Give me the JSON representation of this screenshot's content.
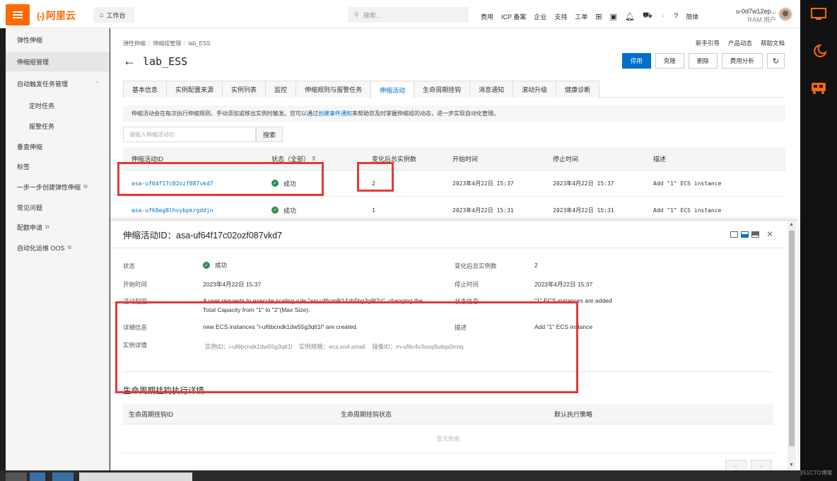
{
  "colors": {
    "brand": "#ff6a00",
    "primary": "#0070cc",
    "success": "#2e8b57",
    "highlight": "#e53935"
  },
  "topbar": {
    "logo": "阿里云",
    "logo_mark": "(-)",
    "workbench": "工作台",
    "search_placeholder": "搜索...",
    "nav": [
      "费用",
      "ICP 备案",
      "企业",
      "支持",
      "工单"
    ],
    "lang": "简体",
    "user_name": "u-0d7w12ep...",
    "user_role": "RAM 用户"
  },
  "sidebar": {
    "items": [
      {
        "label": "弹性伸缩"
      },
      {
        "label": "伸缩组管理"
      },
      {
        "label": "自动触发任务管理"
      },
      {
        "label": "定时任务"
      },
      {
        "label": "报警任务"
      },
      {
        "label": "垂直伸缩"
      },
      {
        "label": "标签"
      },
      {
        "label": "一步一步创建弹性伸缩"
      },
      {
        "label": "常见问题"
      },
      {
        "label": "配额申请"
      },
      {
        "label": "自动化运维 OOS"
      }
    ]
  },
  "breadcrumb": [
    "弹性伸缩",
    "伸缩组管理",
    "lab_ESS"
  ],
  "toplinks": [
    "新手引导",
    "产品动态",
    "帮助文档"
  ],
  "page_title": "lab_ESS",
  "actions": [
    "停用",
    "克隆",
    "删除",
    "费用分析"
  ],
  "tabs": [
    "基本信息",
    "实例配置来源",
    "实例列表",
    "监控",
    "伸缩规则与报警任务",
    "伸缩活动",
    "生命周期挂钩",
    "消息通知",
    "滚动升级",
    "健康诊断"
  ],
  "notice": {
    "before": "伸缩活动会在每次执行伸缩规则、手动添加或移出实例时触发。您可以通过",
    "link": "创建事件通知",
    "after": "来帮助您及时掌握伸缩组的动态，进一步实现自动化管理。"
  },
  "filter": {
    "placeholder": "请输入伸缩活动ID",
    "button": "搜索"
  },
  "table": {
    "headers": [
      "伸缩活动ID",
      "状态（全部）",
      "变化后总实例数",
      "开始时间",
      "停止时间",
      "描述"
    ],
    "rows": [
      {
        "id": "asa-uf64f17c02ozf087vkd7",
        "status": "成功",
        "count": "2",
        "start": "2023年4月22日 15:37",
        "stop": "2023年4月22日 15:37",
        "desc": "Add \"1\" ECS instance"
      },
      {
        "id": "asa-uf68eg8lhvybpkrgddjn",
        "status": "成功",
        "count": "1",
        "start": "2023年4月22日 15:31",
        "stop": "2023年4月22日 15:31",
        "desc": "Add \"1\" ECS instance"
      }
    ]
  },
  "drawer": {
    "title": "伸缩活动ID：asa-uf64f17c02ozf087vkd7",
    "labels": {
      "status": "状态",
      "start": "开始时间",
      "cause": "活动起因",
      "detail": "详细信息",
      "instance_detail": "实例详情",
      "count": "变化后总实例数",
      "stop": "停止时间",
      "status_info": "状态信息",
      "desc": "描述"
    },
    "values": {
      "status": "成功",
      "start": "2023年4月22日 15:37",
      "cause_line1": "A user requests to execute scaling rule \"asr-uf6cm9i14zb5bg3g9t7q\", changing the",
      "cause_line2": "Total Capacity from \"1\" to \"2\"(Max Size).",
      "detail": "new ECS instances \"i-uf6bcndk1dw55g3qtl1l\" are created.",
      "instance_detail": "实例ID：i-uf6bcndk1dw55g3qtl1l    实例规格：ecs.xn4.small    镜像ID：m-uf6c4v3soq9uitqs0rmq",
      "count": "2",
      "stop": "2023年4月22日 15:37",
      "status_info": "\"1\" ECS instances are added",
      "desc": "Add \"1\" ECS instance"
    },
    "lifecycle": {
      "title": "生命周期挂钩执行详情",
      "headers": [
        "生命周期挂钩ID",
        "生命周期挂钩状态",
        "默认执行策略"
      ],
      "empty": "暂无数据"
    }
  },
  "watermark": "@51CTO博客"
}
